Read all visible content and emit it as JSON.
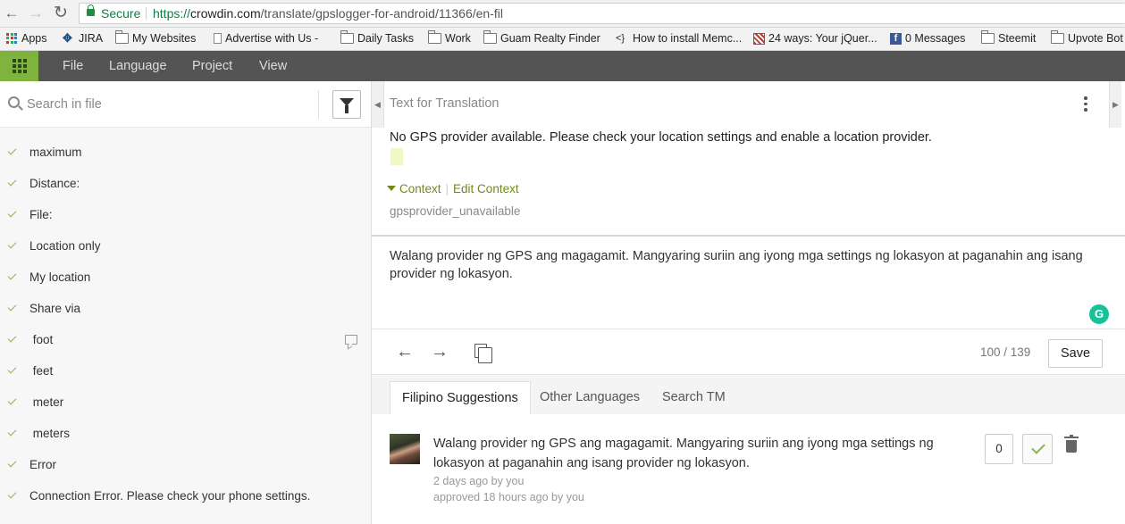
{
  "browser": {
    "secure_label": "Secure",
    "url_scheme": "https://",
    "url_host": "crowdin.com",
    "url_path": "/translate/gpslogger-for-android/11366/en-fil"
  },
  "bookmarks": [
    {
      "label": "Apps",
      "icon": "apps-grid-icon"
    },
    {
      "label": "JIRA",
      "icon": "jira-icon"
    },
    {
      "label": "My Websites",
      "icon": "folder-icon"
    },
    {
      "label": "Advertise with Us -",
      "icon": "page-icon"
    },
    {
      "label": "Daily Tasks",
      "icon": "folder-icon"
    },
    {
      "label": "Work",
      "icon": "folder-icon"
    },
    {
      "label": "Guam Realty Finder",
      "icon": "folder-icon"
    },
    {
      "label": "How to install Memc...",
      "icon": "code-icon"
    },
    {
      "label": "24 ways: Your jQuer...",
      "icon": "pattern-icon"
    },
    {
      "label": "0 Messages",
      "icon": "facebook-icon"
    },
    {
      "label": "Steemit",
      "icon": "folder-icon"
    },
    {
      "label": "Upvote Bot",
      "icon": "folder-icon"
    }
  ],
  "toolbar": {
    "menu": [
      "File",
      "Language",
      "Project",
      "View"
    ]
  },
  "sidebar": {
    "search_placeholder": "Search in file",
    "items": [
      {
        "label": "maximum",
        "has_comment": false
      },
      {
        "label": "Distance:",
        "has_comment": false
      },
      {
        "label": "File:",
        "has_comment": false
      },
      {
        "label": "Location only",
        "has_comment": false
      },
      {
        "label": "My location",
        "has_comment": false
      },
      {
        "label": "Share via",
        "has_comment": false
      },
      {
        "label": " foot",
        "has_comment": true
      },
      {
        "label": " feet",
        "has_comment": false
      },
      {
        "label": " meter",
        "has_comment": false
      },
      {
        "label": " meters",
        "has_comment": false
      },
      {
        "label": "Error",
        "has_comment": false
      },
      {
        "label": "Connection Error. Please check your phone settings.",
        "has_comment": false
      }
    ]
  },
  "editor": {
    "header": "Text for Translation",
    "source_text": "No GPS provider available. Please check your location settings and enable a  location provider.",
    "context_label": "Context",
    "edit_context_label": "Edit Context",
    "context_key": "gpsprovider_unavailable",
    "translation_text": "Walang provider ng GPS ang magagamit. Mangyaring suriin ang iyong mga settings ng lokasyon at paganahin ang isang provider ng lokasyon.",
    "grammarly_glyph": "G",
    "counter": "100 / 139",
    "save_label": "Save",
    "prev_glyph": "←",
    "next_glyph": "→"
  },
  "tabs": [
    "Filipino Suggestions",
    "Other Languages",
    "Search TM"
  ],
  "suggestion": {
    "text": "Walang provider ng GPS ang magagamit. Mangyaring suriin ang iyong mga settings ng lokasyon at paganahin ang isang provider ng lokasyon.",
    "meta_created": "2 days ago by you",
    "meta_approved": "approved 18 hours ago by you",
    "votes": "0"
  },
  "colors": {
    "accent_green": "#7fb33d",
    "toolbar_bg": "#545454",
    "check_green": "#8bb64a",
    "context_green": "#6f8a17"
  }
}
